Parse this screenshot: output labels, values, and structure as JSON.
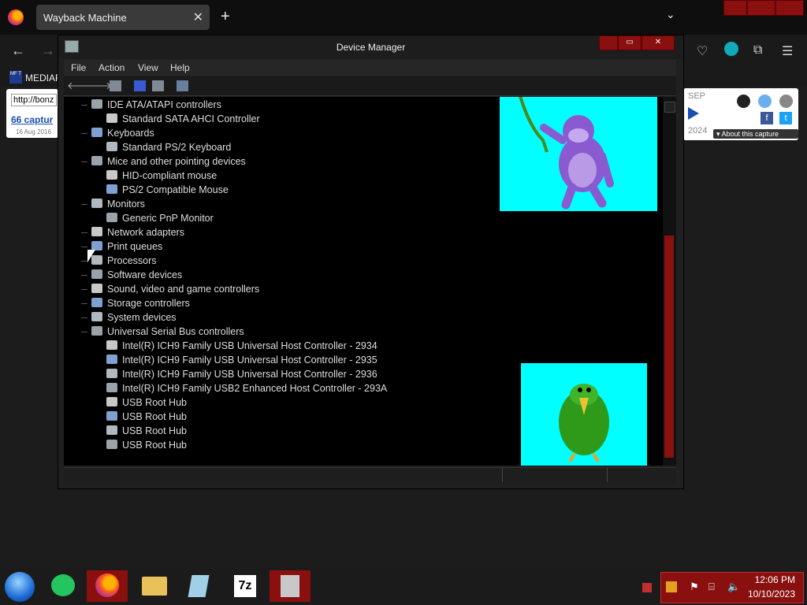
{
  "browser": {
    "tab_title": "Wayback Machine",
    "tab_close": "✕",
    "new_tab": "+",
    "tab_list": "⌄",
    "back": "←",
    "forward": "→",
    "bookmark_icon_text": "MF T",
    "bookmark_label": "MEDIAF"
  },
  "wayback": {
    "url_value": "http://bonz",
    "captures": "66 captur",
    "first_date": "16 Aug 2016",
    "month": "SEP",
    "year": "2024",
    "about": "▾ About this capture"
  },
  "device_manager": {
    "title": "Device Manager",
    "menu": [
      "File",
      "Action",
      "View",
      "Help"
    ],
    "toolbar": [
      "back-arrow",
      "forward-arrow",
      "properties",
      "help",
      "update-driver",
      "scan-hardware"
    ],
    "tree": [
      {
        "label": "IDE ATA/ATAPI controllers",
        "level": 0
      },
      {
        "label": "Standard SATA AHCI Controller",
        "level": 1
      },
      {
        "label": "Keyboards",
        "level": 0
      },
      {
        "label": "Standard PS/2 Keyboard",
        "level": 1
      },
      {
        "label": "Mice and other pointing devices",
        "level": 0
      },
      {
        "label": "HID-compliant mouse",
        "level": 1
      },
      {
        "label": "PS/2 Compatible Mouse",
        "level": 1
      },
      {
        "label": "Monitors",
        "level": 0
      },
      {
        "label": "Generic PnP Monitor",
        "level": 1
      },
      {
        "label": "Network adapters",
        "level": 0
      },
      {
        "label": "Print queues",
        "level": 0
      },
      {
        "label": "Processors",
        "level": 0
      },
      {
        "label": "Software devices",
        "level": 0
      },
      {
        "label": "Sound, video and game controllers",
        "level": 0
      },
      {
        "label": "Storage controllers",
        "level": 0
      },
      {
        "label": "System devices",
        "level": 0
      },
      {
        "label": "Universal Serial Bus controllers",
        "level": 0
      },
      {
        "label": "Intel(R) ICH9 Family USB Universal Host Controller - 2934",
        "level": 1
      },
      {
        "label": "Intel(R) ICH9 Family USB Universal Host Controller - 2935",
        "level": 1
      },
      {
        "label": "Intel(R) ICH9 Family USB Universal Host Controller - 2936",
        "level": 1
      },
      {
        "label": "Intel(R) ICH9 Family USB2 Enhanced Host Controller - 293A",
        "level": 1
      },
      {
        "label": "USB Root Hub",
        "level": 1
      },
      {
        "label": "USB Root Hub",
        "level": 1
      },
      {
        "label": "USB Root Hub",
        "level": 1
      },
      {
        "label": "USB Root Hub",
        "level": 1
      }
    ]
  },
  "taskbar": {
    "apps": [
      "notes-app",
      "firefox",
      "file-explorer",
      "notepad",
      "7zip",
      "device-manager"
    ],
    "sevenzip_label": "7z",
    "time": "12:06 PM",
    "date": "10/10/2023"
  },
  "colors": {
    "accent_red": "#8a1010",
    "sprite_bg": "#00ffff",
    "window_bg": "#202020"
  }
}
